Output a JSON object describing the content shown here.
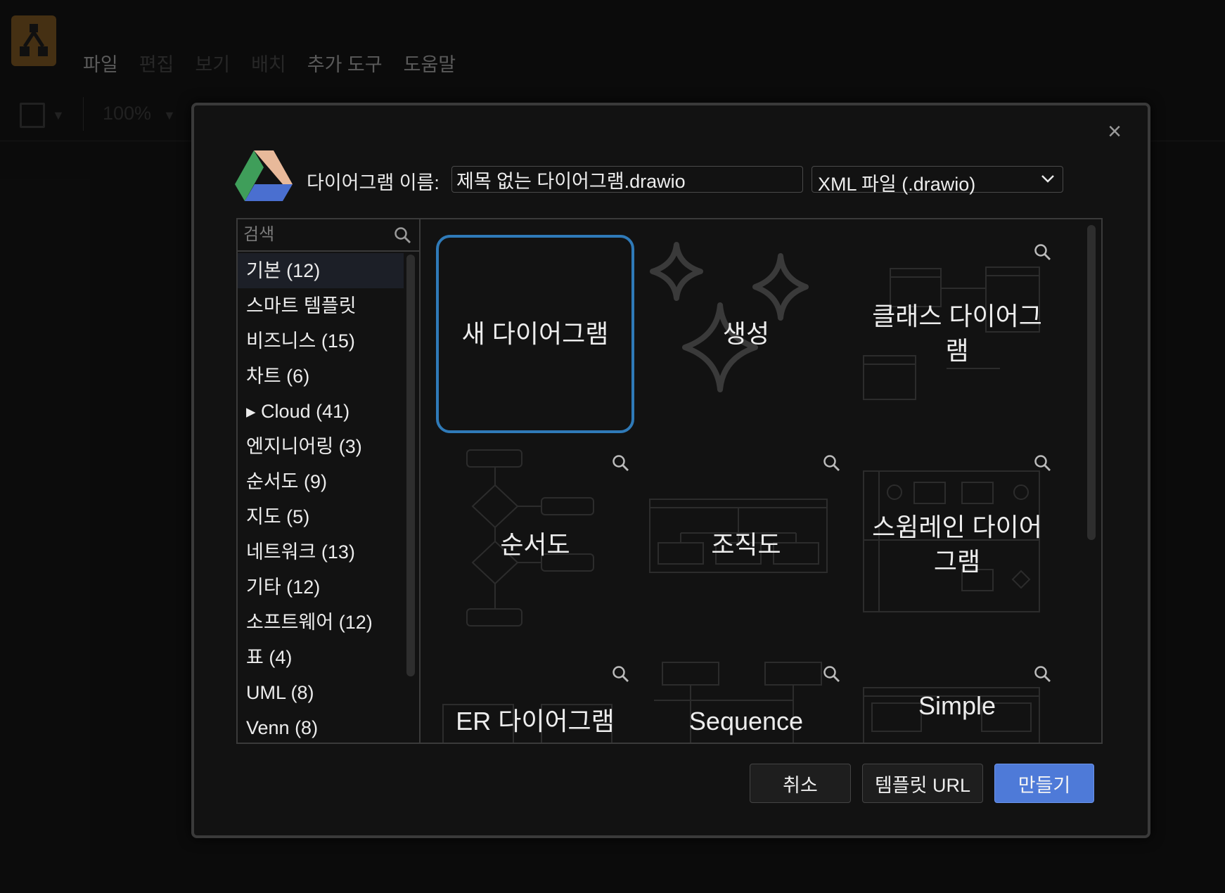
{
  "menubar": {
    "items": [
      "파일",
      "편집",
      "보기",
      "배치",
      "추가 도구",
      "도움말"
    ]
  },
  "toolbar": {
    "zoom": "100%"
  },
  "dialog": {
    "close": "×",
    "name_label": "다이어그램 이름:",
    "file_name": "제목 없는 다이어그램.drawio",
    "format": "XML 파일 (.drawio)",
    "search_placeholder": "검색",
    "categories": [
      {
        "label": "기본 (12)"
      },
      {
        "label": "스마트 템플릿"
      },
      {
        "label": "비즈니스 (15)"
      },
      {
        "label": "차트 (6)"
      },
      {
        "label": "▸ Cloud (41)"
      },
      {
        "label": "엔지니어링 (3)"
      },
      {
        "label": "순서도 (9)"
      },
      {
        "label": "지도 (5)"
      },
      {
        "label": "네트워크 (13)"
      },
      {
        "label": "기타 (12)"
      },
      {
        "label": "소프트웨어 (12)"
      },
      {
        "label": "표 (4)"
      },
      {
        "label": "UML (8)"
      },
      {
        "label": "Venn (8)"
      }
    ],
    "tiles": [
      {
        "label": "새 다이어그램"
      },
      {
        "label": "생성"
      },
      {
        "label": "클래스 다이어그램"
      },
      {
        "label": "순서도"
      },
      {
        "label": "조직도"
      },
      {
        "label": "스윔레인 다이어그램"
      },
      {
        "label": "ER 다이어그램"
      },
      {
        "label": "Sequence"
      },
      {
        "label": "Simple"
      }
    ],
    "buttons": {
      "cancel": "취소",
      "template_url": "템플릿 URL",
      "create": "만들기"
    }
  },
  "colors": {
    "accent": "#4e7ad8",
    "selected_border": "#2f7ab8",
    "background": "#121212"
  }
}
